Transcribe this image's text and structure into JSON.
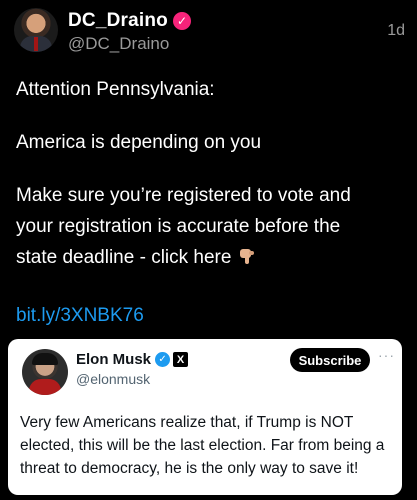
{
  "post": {
    "author_name": "DC_Draino",
    "handle": "@DC_Draino",
    "time": "1d",
    "lines": [
      "Attention Pennsylvania:",
      "America is depending on you",
      "Make sure you’re registered to vote and",
      "your registration is accurate before the",
      "state deadline - click here"
    ],
    "emoji_icon": "backhand-index-pointing-down-icon",
    "link": "bit.ly/3XNBK76"
  },
  "quoted": {
    "name": "Elon Musk",
    "handle": "@elonmusk",
    "subscribe_label": "Subscribe",
    "more_label": "···",
    "text": "Very few Americans realize that, if Trump is NOT elected, this will be the last election. Far from being a threat to democracy, he is the only way to save it!"
  },
  "colors": {
    "background": "#000000",
    "link": "#1d9bf0",
    "verified_pink": "#f7237a",
    "verified_blue": "#1d9bf0"
  }
}
